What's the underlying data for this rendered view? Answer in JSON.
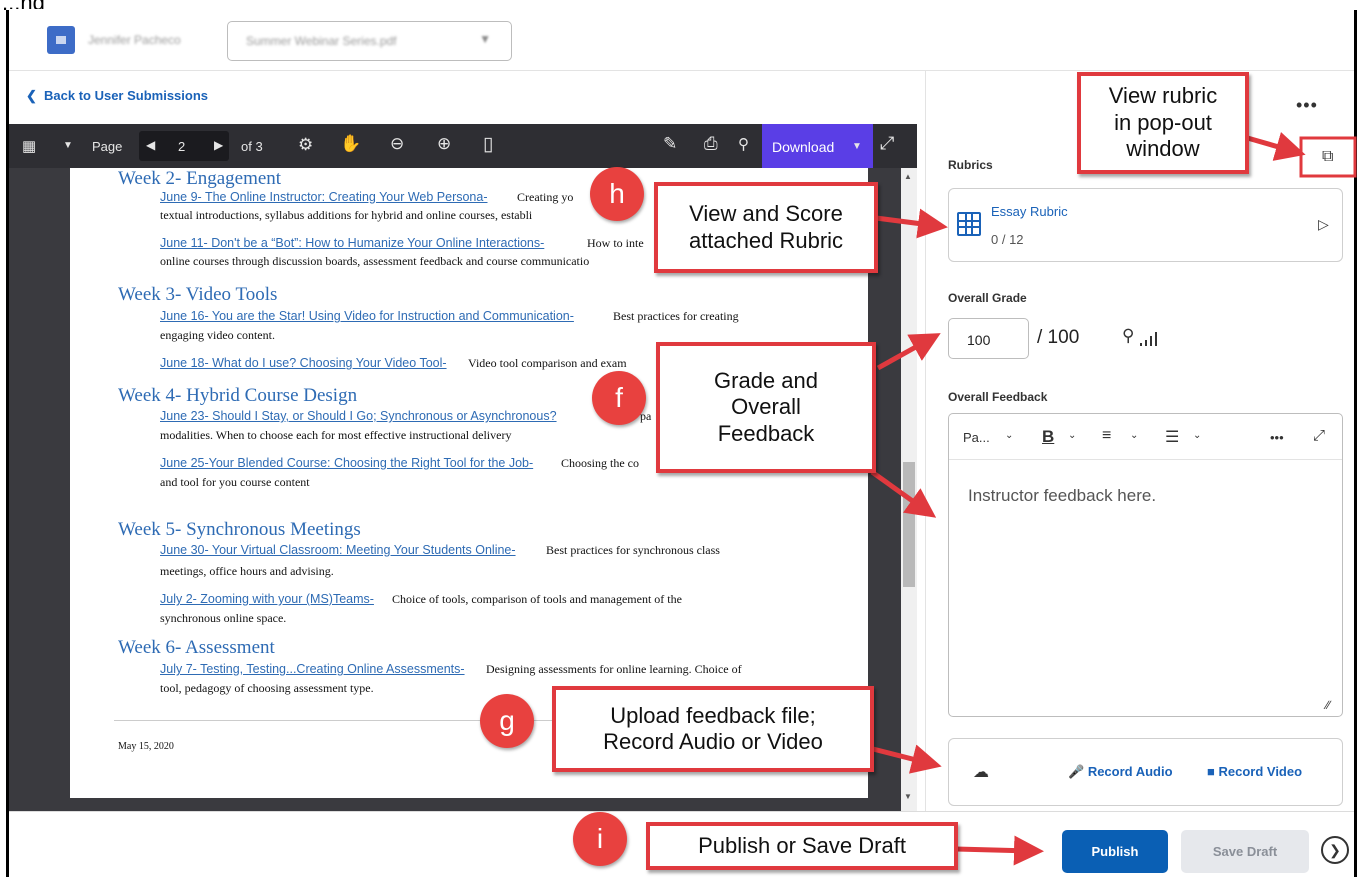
{
  "header": {
    "user_name": "Jennifer Pacheco",
    "file_select": "Summer Webinar Series.pdf"
  },
  "viewer": {
    "back_link": "Back to User Submissions",
    "page_label": "Page",
    "page_number": "2",
    "page_total": "of 3",
    "download_label": "Download"
  },
  "document": {
    "weeks": [
      {
        "title": "Week 2- Engagement",
        "items": [
          {
            "link": "June 9- The Online Instructor: Creating Your Web Persona-",
            "desc": " Creating yo",
            "desc2": "textual introductions, syllabus additions for hybrid and online courses, establi"
          },
          {
            "link": "June 11- Don't be a “Bot”: How to Humanize Your Online Interactions-",
            "desc": " How to inte",
            "desc2": "online courses through discussion boards, assessment feedback and course communicatio"
          }
        ]
      },
      {
        "title": "Week 3- Video Tools",
        "items": [
          {
            "link": "June 16- You are the Star! Using Video for Instruction and Communication-",
            "desc": " Best practices for creating",
            "desc2": "engaging video content."
          },
          {
            "link": "June 18- What do I use? Choosing Your Video Tool-",
            "desc": " Video tool comparison and exam",
            "desc2": ""
          }
        ]
      },
      {
        "title": "Week 4- Hybrid Course Design",
        "items": [
          {
            "link": "June 23- Should I Stay, or Should I Go; Synchronous or Asynchronous?",
            "desc": " pa",
            "desc2": "modalities. When to choose each for most effective instructional delivery"
          },
          {
            "link": "June 25-Your Blended Course: Choosing the Right Tool for the Job-",
            "desc": " Choosing the co",
            "desc2": "and tool for you course content"
          }
        ]
      },
      {
        "title": "Week 5- Synchronous Meetings",
        "items": [
          {
            "link": "June 30- Your Virtual Classroom: Meeting Your Students Online-",
            "desc": " Best practices for synchronous class",
            "desc2": "meetings, office hours and advising."
          },
          {
            "link": "July 2- Zooming with your (MS)Teams-",
            "desc": " Choice of tools, comparison of tools and management of the",
            "desc2": "synchronous online space."
          }
        ]
      },
      {
        "title": "Week 6- Assessment",
        "items": [
          {
            "link": "July 7- Testing, Testing...Creating Online Assessments-",
            "desc": " Designing assessments for online learning. Choice of",
            "desc2": "tool, pedagogy of choosing assessment type."
          }
        ]
      }
    ],
    "footer_date": "May 15, 2020"
  },
  "right": {
    "more": "•••",
    "rubrics_label": "Rubrics",
    "rubric_name": "Essay Rubric",
    "rubric_score": "0 / 12",
    "grade_label": "Overall Grade",
    "grade_value": "100",
    "grade_outof": "/ 100",
    "feedback_label": "Overall Feedback",
    "editor": {
      "paragraph": "Pa...",
      "bold": "B",
      "more": "•••",
      "text": "Instructor feedback here."
    },
    "record_audio": "Record Audio",
    "record_video": "Record Video"
  },
  "footer": {
    "publish": "Publish",
    "save_draft": "Save Draft"
  },
  "annotations": {
    "top_fragment": "...ng",
    "popout_callout": "View rubric\nin pop-out\nwindow",
    "rubric_callout": "View and Score\nattached Rubric",
    "grade_callout": "Grade and\nOverall\nFeedback",
    "upload_callout": "Upload feedback file;\nRecord Audio or Video",
    "publish_callout": "Publish or Save Draft",
    "markers": {
      "h": "h",
      "f": "f",
      "g": "g",
      "i": "i"
    },
    "accent_color": "#e0393e"
  }
}
